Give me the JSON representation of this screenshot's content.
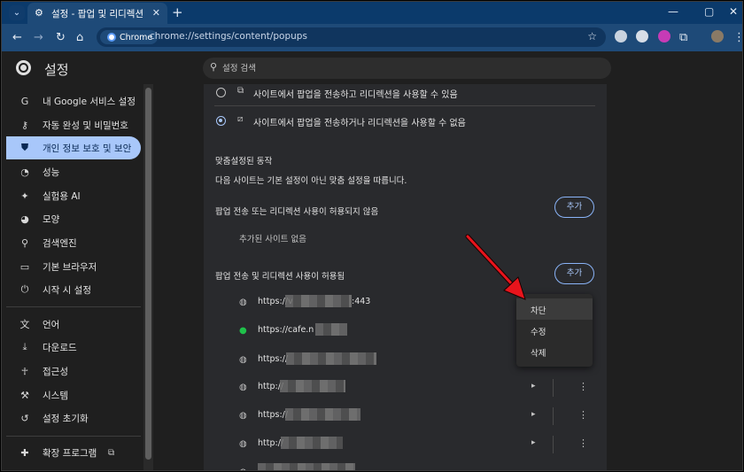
{
  "browser": {
    "tab_title": "설정 - 팝업 및 리디렉션",
    "omnibox_chip": "Chrome",
    "url": "chrome://settings/content/popups"
  },
  "header": {
    "title": "설정",
    "search_placeholder": "설정 검색"
  },
  "sidebar": {
    "items": [
      {
        "label": "내 Google 서비스 설정",
        "icon": "google-icon"
      },
      {
        "label": "자동 완성 및 비밀번호",
        "icon": "key-icon"
      },
      {
        "label": "개인 정보 보호 및 보안",
        "icon": "shield-icon"
      },
      {
        "label": "성능",
        "icon": "speedometer-icon"
      },
      {
        "label": "실험용 AI",
        "icon": "sparkle-icon"
      },
      {
        "label": "모양",
        "icon": "palette-icon"
      },
      {
        "label": "검색엔진",
        "icon": "search-icon"
      },
      {
        "label": "기본 브라우저",
        "icon": "browser-icon"
      },
      {
        "label": "시작 시 설정",
        "icon": "power-icon"
      },
      {
        "label": "언어",
        "icon": "translate-icon"
      },
      {
        "label": "다운로드",
        "icon": "download-icon"
      },
      {
        "label": "접근성",
        "icon": "accessibility-icon"
      },
      {
        "label": "시스템",
        "icon": "wrench-icon"
      },
      {
        "label": "설정 초기화",
        "icon": "reset-icon"
      },
      {
        "label": "확장 프로그램",
        "icon": "puzzle-icon"
      }
    ]
  },
  "content": {
    "option_allow": "사이트에서 팝업을 전송하고 리디렉션을 사용할 수 있음",
    "option_block": "사이트에서 팝업을 전송하거나 리디렉션을 사용할 수 없음",
    "custom_heading": "맞춤설정된 동작",
    "custom_desc": "다음 사이트는 기본 설정이 아닌 맞춤 설정을 따릅니다.",
    "blocked_heading": "팝업 전송 또는 리디렉션 사용이 허용되지 않음",
    "blocked_empty": "추가된 사이트 없음",
    "allowed_heading": "팝업 전송 및 리디렉션 사용이 허용됨",
    "add_label": "추가",
    "sites": [
      {
        "visible_text": "https://v",
        "suffix": ":443"
      },
      {
        "visible_text": "https://cafe.n",
        "suffix": ""
      },
      {
        "visible_text": "https://",
        "suffix": ""
      },
      {
        "visible_text": "http://",
        "suffix": ""
      },
      {
        "visible_text": "https://",
        "suffix": ""
      },
      {
        "visible_text": "http://",
        "suffix": ""
      }
    ]
  },
  "context_menu": {
    "items": [
      "차단",
      "수정",
      "삭제"
    ]
  },
  "colors": {
    "tab_strip": "#0b3a6b",
    "toolbar": "#1e4a78",
    "accent": "#a8c7fa",
    "annotation_arrow": "#e8141c"
  }
}
